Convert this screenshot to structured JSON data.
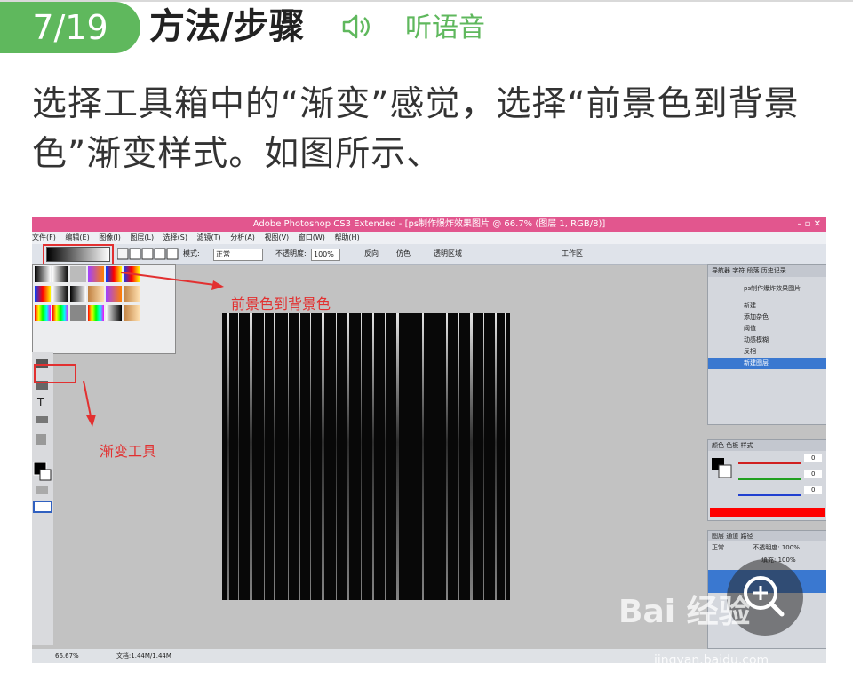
{
  "step": {
    "number": "7/19",
    "title": "方法/步骤",
    "listen_label": "听语音"
  },
  "paragraph": "选择工具箱中的“渐变”感觉，选择“前景色到背景色”渐变样式。如图所示、",
  "screenshot": {
    "window_title": "Adobe Photoshop CS3 Extended - [ps制作爆炸效果图片 @ 66.7% (图层 1, RGB/8)]",
    "menu": [
      "文件(F)",
      "编辑(E)",
      "图像(I)",
      "图层(L)",
      "选择(S)",
      "滤镜(T)",
      "分析(A)",
      "视图(V)",
      "窗口(W)",
      "帮助(H)"
    ],
    "options": {
      "mode_label": "模式:",
      "mode_value": "正常",
      "opacity_label": "不透明度:",
      "opacity_value": "100%",
      "reverse": "反向",
      "dither": "仿色",
      "transparency": "透明区域",
      "workspace": "工作区"
    },
    "annotation_gradient": "前景色到背景色",
    "annotation_tool": "渐变工具",
    "history_panel": {
      "tabs": [
        "导航器",
        "字符",
        "段落",
        "历史记录"
      ],
      "snapshot": "ps制作爆炸效果图片",
      "items": [
        "新建",
        "添加杂色",
        "阈值",
        "动感模糊",
        "反相",
        "新建图层"
      ]
    },
    "color_panel": {
      "tabs": [
        "颜色",
        "色板",
        "样式"
      ],
      "values": [
        "0",
        "0",
        "0"
      ]
    },
    "layers_panel": {
      "tabs": [
        "图层",
        "通道",
        "路径"
      ],
      "mode": "正常",
      "opacity_label": "不透明度:",
      "opacity": "100%",
      "fill_label": "填充:",
      "fill": "100%"
    },
    "status": {
      "zoom": "66.67%",
      "doc": "文档:1.44M/1.44M"
    }
  },
  "watermark": {
    "brand": "Bai 经验",
    "url": "jingyan.baidu.com"
  },
  "colors": {
    "accent_green": "#5fb85d",
    "annotation_red": "#e23030",
    "title_bar_pink": "#e2568e"
  }
}
